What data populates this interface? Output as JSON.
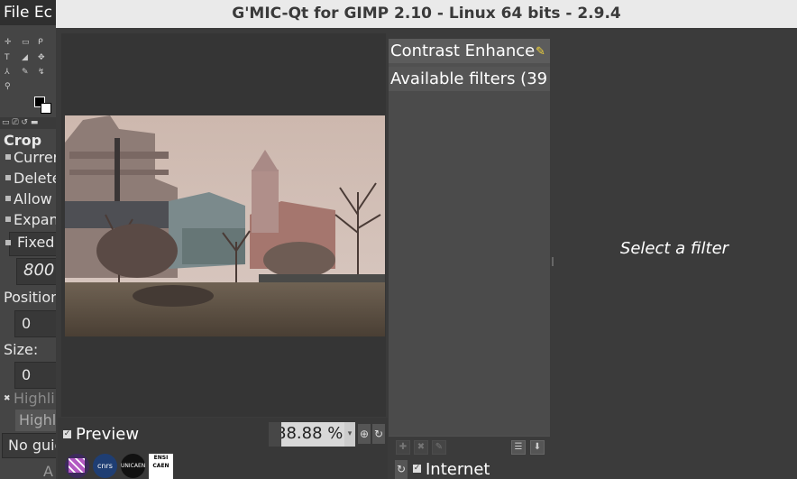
{
  "gimp": {
    "menu_text": "File Ec",
    "tool_options_title": "Crop",
    "options": [
      "Curren",
      "Delete",
      "Allow",
      "Expan"
    ],
    "fixed_label": "Fixed",
    "fixed_value": "800",
    "position_label": "Position",
    "position_value": "0",
    "size_label": "Size:",
    "size_value": "0",
    "highlight_label": "Highli",
    "highlight_dropdown": "Highl",
    "guides_dropdown": "No guid",
    "bottom_button": "A"
  },
  "dialog": {
    "title": "G'MIC-Qt for GIMP 2.10 - Linux 64 bits - 2.9.4",
    "preview_label": "Preview",
    "zoom_value": "88.88 %",
    "filter_search": "Contrast Enhance",
    "filters_header": "Available filters (39",
    "internet_label": "Internet",
    "empty_message": "Select a filter"
  },
  "icons": [
    "zoom-in-icon",
    "refresh-icon",
    "brush-icon",
    "dropdown-icon",
    "download-icon",
    "list-icon",
    "tree-icon"
  ]
}
